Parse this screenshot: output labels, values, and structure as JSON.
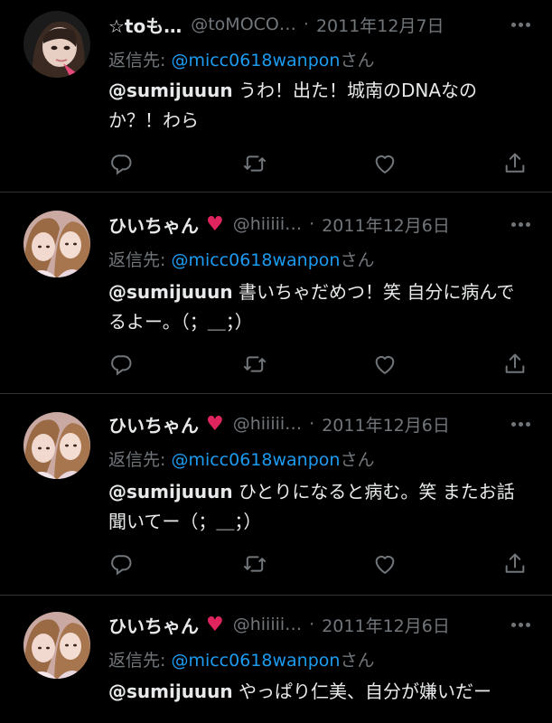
{
  "tweets": [
    {
      "display_name": "☆toも…",
      "handle": "@toMOCO…",
      "separator": "·",
      "date": "2011年12月7日",
      "heart": "",
      "reply_label": "返信先:",
      "reply_to": "@micc0618wanpon",
      "reply_suffix": "さん",
      "mention": "@sumijuuun",
      "text": " うわ！出た！城南のDNAなのか？！わら",
      "avatar": "girl-portrait"
    },
    {
      "display_name": "ひいちゃん",
      "heart": "♥",
      "handle": "@hiiiii…",
      "separator": "·",
      "date": "2011年12月6日",
      "reply_label": "返信先:",
      "reply_to": "@micc0618wanpon",
      "reply_suffix": "さん",
      "mention": "@sumijuuun",
      "text": " 書いちゃだめつ！笑 自分に病んでるよー。（；＿；）",
      "avatar": "two-girls-selfie"
    },
    {
      "display_name": "ひいちゃん",
      "heart": "♥",
      "handle": "@hiiiii…",
      "separator": "·",
      "date": "2011年12月6日",
      "reply_label": "返信先:",
      "reply_to": "@micc0618wanpon",
      "reply_suffix": "さん",
      "mention": "@sumijuuun",
      "text": " ひとりになると病む。笑 またお話聞いてー（；＿；）",
      "avatar": "two-girls-selfie"
    },
    {
      "display_name": "ひいちゃん",
      "heart": "♥",
      "handle": "@hiiiii…",
      "separator": "·",
      "date": "2011年12月6日",
      "reply_label": "返信先:",
      "reply_to": "@micc0618wanpon",
      "reply_suffix": "さん",
      "mention": "@sumijuuun",
      "text": " やっぱり仁美、自分が嫌いだー",
      "avatar": "two-girls-selfie"
    }
  ],
  "icons": {
    "reply": "reply-icon",
    "retweet": "retweet-icon",
    "like": "like-icon",
    "share": "share-icon",
    "more": "more-icon"
  },
  "colors": {
    "background": "#000000",
    "text": "#e7e9ea",
    "muted": "#71767b",
    "link": "#1d9bf0",
    "heart": "#e0245e",
    "divider": "#2f3336"
  }
}
